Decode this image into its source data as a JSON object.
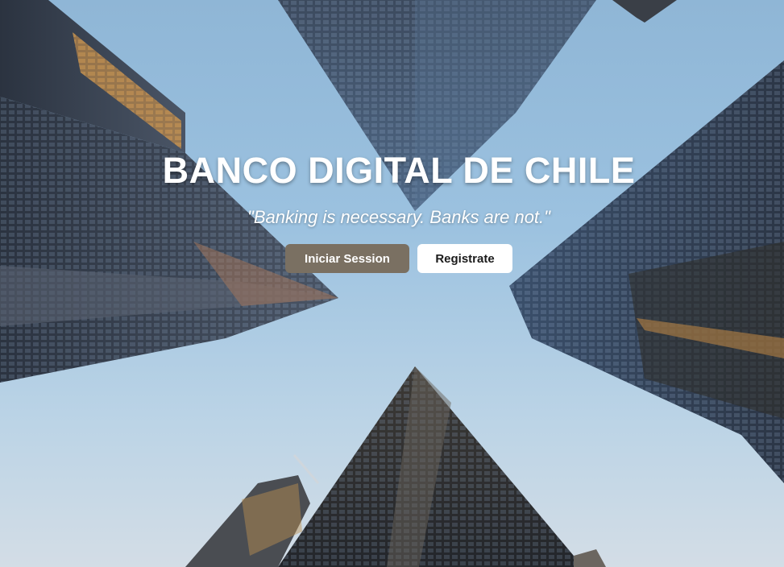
{
  "hero": {
    "title": "BANCO DIGITAL DE CHILE",
    "tagline": "\"Banking is necessary. Banks are not.\"",
    "background_image": "looking-up-at-skyscrapers-photo"
  },
  "actions": {
    "login_label": "Iniciar Session",
    "register_label": "Registrate"
  },
  "colors": {
    "login_button": "#7a7062",
    "register_button": "#ffffff",
    "title_text": "#ffffff"
  }
}
